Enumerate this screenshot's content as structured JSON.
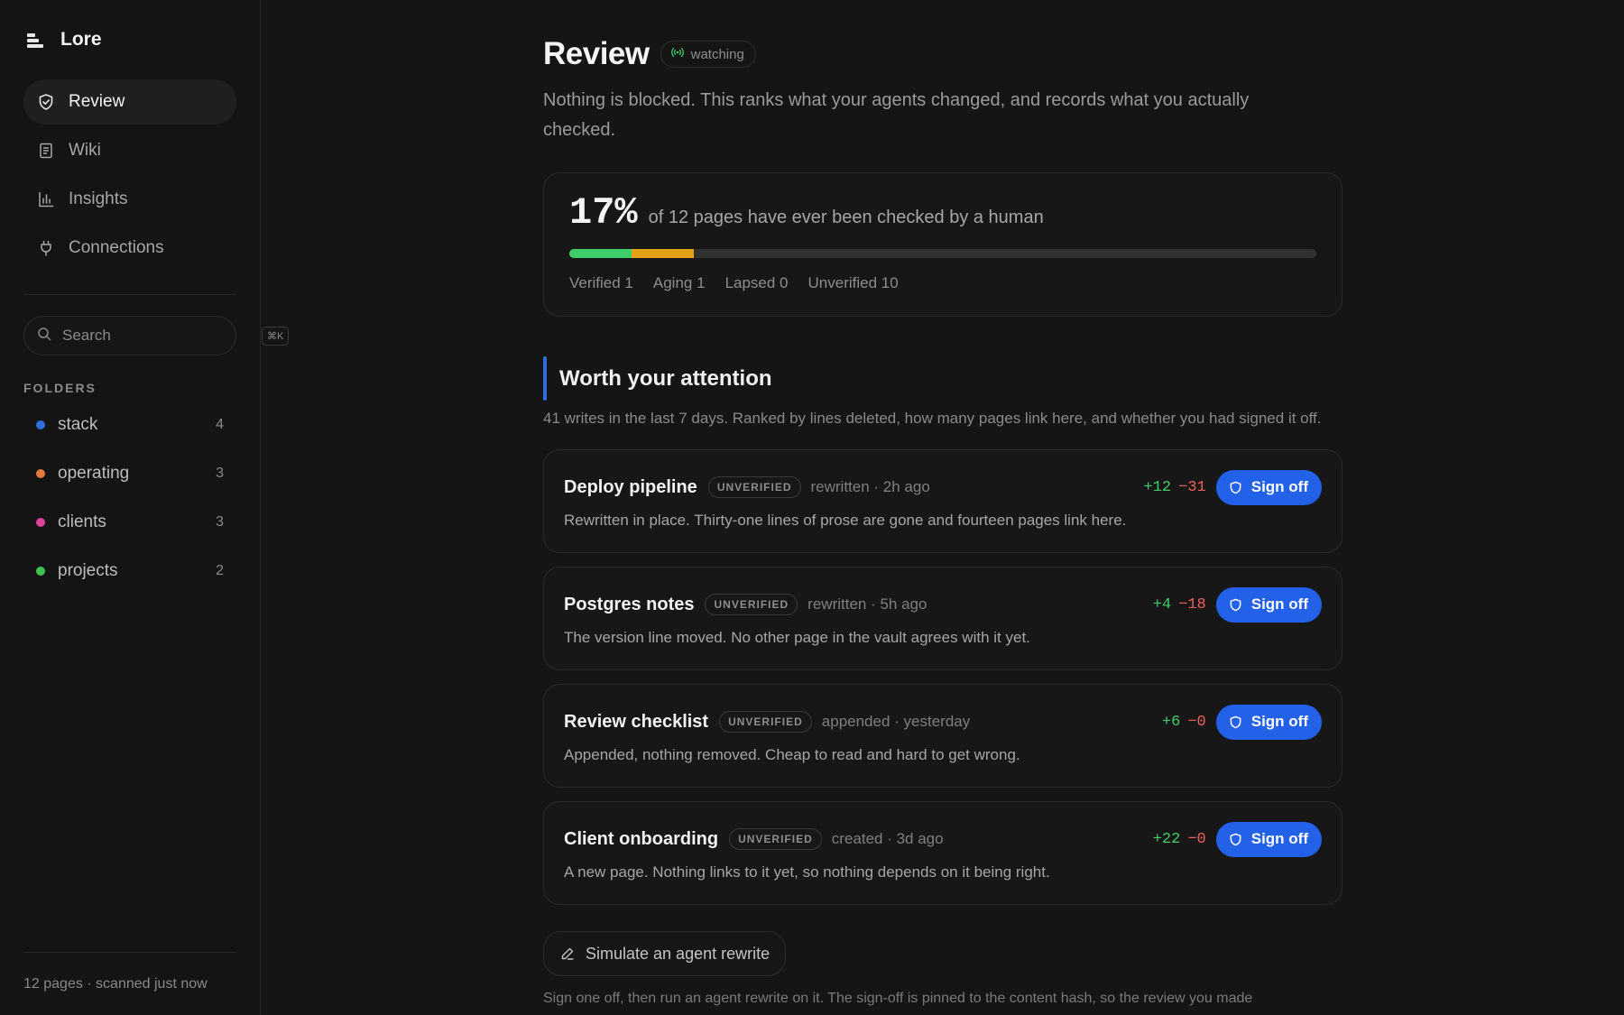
{
  "app": {
    "name": "Lore"
  },
  "sidebar": {
    "nav": [
      {
        "label": "Review",
        "icon": "shield-check-icon",
        "active": true
      },
      {
        "label": "Wiki",
        "icon": "document-icon",
        "active": false
      },
      {
        "label": "Insights",
        "icon": "bar-chart-icon",
        "active": false
      },
      {
        "label": "Connections",
        "icon": "plug-icon",
        "active": false
      }
    ],
    "search": {
      "placeholder": "Search",
      "shortcut": "⌘K"
    },
    "folders_heading": "FOLDERS",
    "folders": [
      {
        "name": "stack",
        "count": "4",
        "color": "#2f6de0"
      },
      {
        "name": "operating",
        "count": "3",
        "color": "#e8793a"
      },
      {
        "name": "clients",
        "count": "3",
        "color": "#e0419a"
      },
      {
        "name": "projects",
        "count": "2",
        "color": "#3fc24f"
      }
    ],
    "footer": "12 pages · scanned just now"
  },
  "main": {
    "title": "Review",
    "status_pill": "watching",
    "subtitle": "Nothing is blocked. This ranks what your agents changed, and records what you actually checked.",
    "stats": {
      "percent": "17%",
      "text": "of 12 pages have ever been checked by a human",
      "segments": [
        {
          "name": "Verified",
          "value": 1,
          "color": "#3ecf6a"
        },
        {
          "name": "Aging",
          "value": 1,
          "color": "#e3a21a"
        },
        {
          "name": "Lapsed",
          "value": 0,
          "color": "#7a7a7a"
        },
        {
          "name": "Unverified",
          "value": 10,
          "color": "#303030"
        }
      ],
      "total": 12,
      "legend": [
        "Verified 1",
        "Aging 1",
        "Lapsed 0",
        "Unverified 10"
      ]
    },
    "section": {
      "title": "Worth your attention",
      "subtitle": "41 writes in the last 7 days. Ranked by lines deleted, how many pages link here, and whether you had signed it off."
    },
    "items": [
      {
        "title": "Deploy pipeline",
        "badge": "UNVERIFIED",
        "meta": "rewritten · 2h ago",
        "added": "+12",
        "deleted": "−31",
        "action": "Sign off",
        "description": "Rewritten in place. Thirty-one lines of prose are gone and fourteen pages link here."
      },
      {
        "title": "Postgres notes",
        "badge": "UNVERIFIED",
        "meta": "rewritten · 5h ago",
        "added": "+4",
        "deleted": "−18",
        "action": "Sign off",
        "description": "The version line moved. No other page in the vault agrees with it yet."
      },
      {
        "title": "Review checklist",
        "badge": "UNVERIFIED",
        "meta": "appended · yesterday",
        "added": "+6",
        "deleted": "−0",
        "action": "Sign off",
        "description": "Appended, nothing removed. Cheap to read and hard to get wrong."
      },
      {
        "title": "Client onboarding",
        "badge": "UNVERIFIED",
        "meta": "created · 3d ago",
        "added": "+22",
        "deleted": "−0",
        "action": "Sign off",
        "description": "A new page. Nothing links to it yet, so nothing depends on it being right."
      }
    ],
    "simulate_button": "Simulate an agent rewrite",
    "footnote": "Sign one off, then run an agent rewrite on it. The sign-off is pinned to the content hash, so the review you made"
  }
}
